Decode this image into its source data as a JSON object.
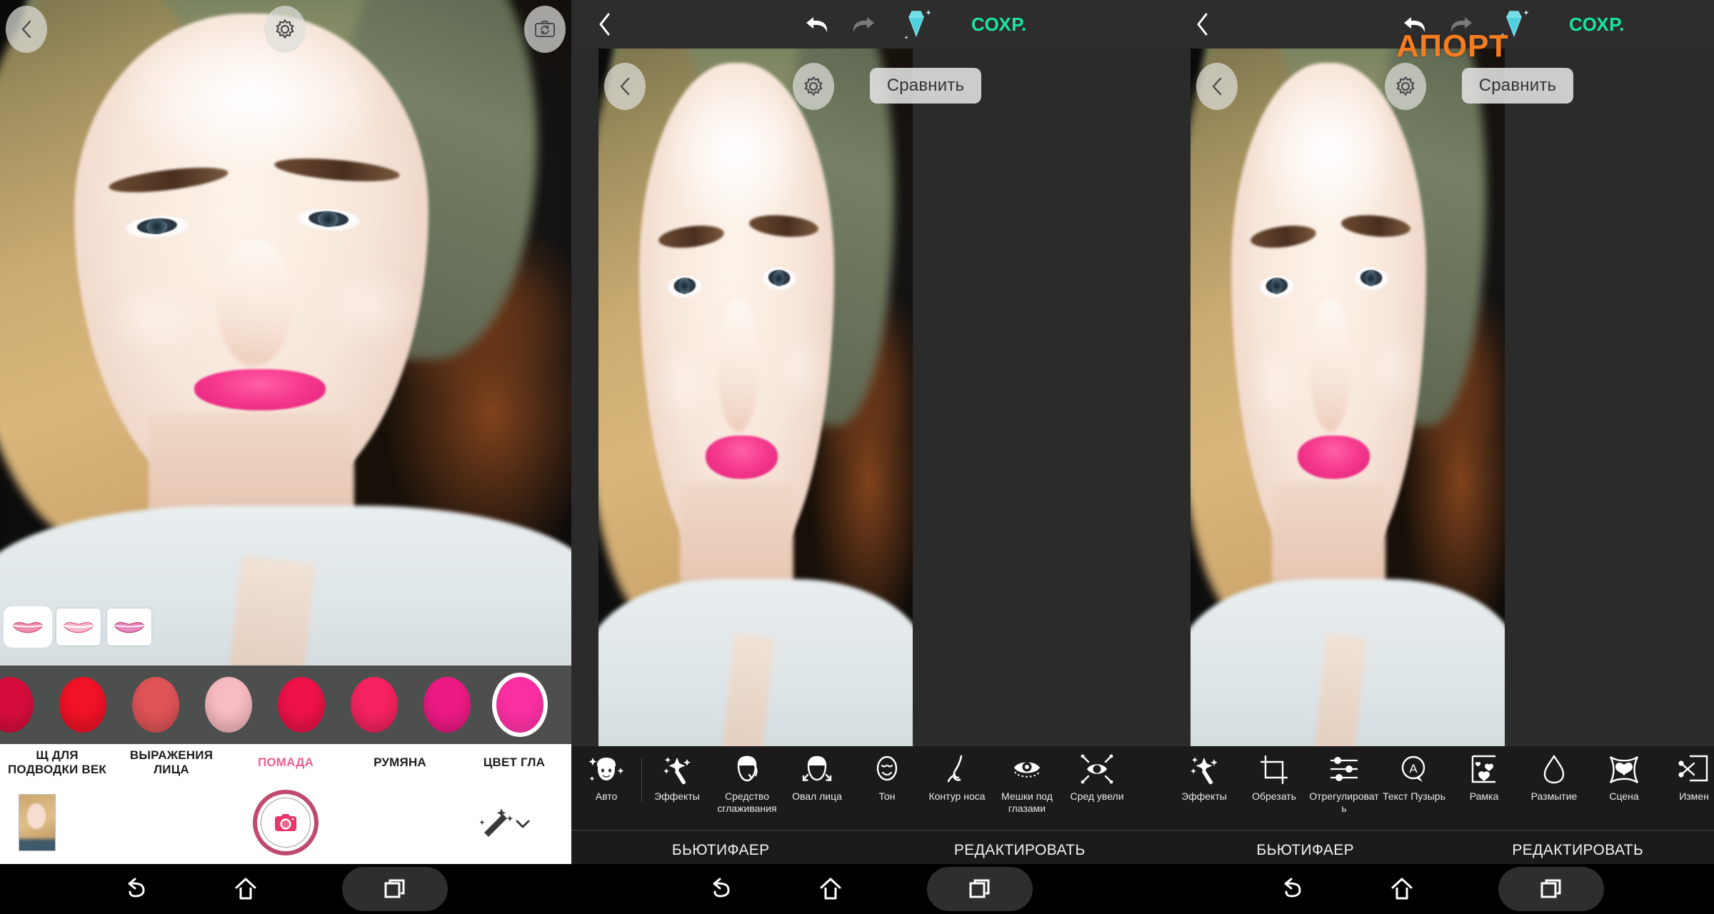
{
  "app": {
    "watermark": "АПОРТ",
    "brand_color": "#F57C1F",
    "save_color": "#16E8A0",
    "accent_pink": "#EF5F94",
    "tab_underline": "#C2185B"
  },
  "left_panel": {
    "top_icons": [
      {
        "name": "back-icon",
        "glyph": "chevron-left"
      },
      {
        "name": "settings-icon",
        "glyph": "gear"
      },
      {
        "name": "switch-camera-icon",
        "glyph": "camera-flip"
      }
    ],
    "lip_thumbs": [
      {
        "label": "lip-style-1",
        "selected": true
      },
      {
        "label": "lip-style-2",
        "selected": false
      },
      {
        "label": "lip-style-3",
        "selected": false
      }
    ],
    "swatches": [
      {
        "color": "#D60D3C",
        "selected": false
      },
      {
        "color": "#F11227",
        "selected": false
      },
      {
        "color": "#E05457",
        "selected": false
      },
      {
        "color": "#F7BBC1",
        "selected": false
      },
      {
        "color": "#EE1249",
        "selected": false
      },
      {
        "color": "#F62360",
        "selected": false
      },
      {
        "color": "#EE1A84",
        "selected": false
      },
      {
        "color": "#FA30A2",
        "selected": true
      }
    ],
    "tabs": [
      {
        "label": "Щ ДЛЯ ПОДВОДКИ ВЕК",
        "active": false
      },
      {
        "label": "ВЫРАЖЕНИЯ ЛИЦА",
        "active": false
      },
      {
        "label": "ПОМАДА",
        "active": true
      },
      {
        "label": "РУМЯНА",
        "active": false
      },
      {
        "label": "ЦВЕТ ГЛА",
        "active": false
      }
    ],
    "camera_bar": {
      "gallery_thumb": "gallery-thumbnail",
      "shutter": "shutter-button",
      "effects": "magic-wand-toggle"
    }
  },
  "mid_panel": {
    "topbar": {
      "back": "back-icon",
      "undo": "undo-icon",
      "redo": "redo-icon",
      "premium": "diamond-icon",
      "save_label": "СОХР."
    },
    "overlay": {
      "back": "back-icon",
      "settings": "gear-icon",
      "compare_label": "Сравнить"
    },
    "tools": [
      {
        "label": "Авто",
        "icon": "auto-face-icon"
      },
      {
        "label": "Эффекты",
        "icon": "magic-wand-icon"
      },
      {
        "label": "Средство сглаживания",
        "icon": "smoothing-face-icon"
      },
      {
        "label": "Овал лица",
        "icon": "face-oval-icon"
      },
      {
        "label": "Тон",
        "icon": "tone-face-icon"
      },
      {
        "label": "Контур носа",
        "icon": "nose-contour-icon"
      },
      {
        "label": "Мешки под глазами",
        "icon": "eye-bags-icon"
      },
      {
        "label": "Сред увели",
        "icon": "eye-enlarge-icon"
      }
    ],
    "tabs": [
      {
        "label": "БЬЮТИФАЕР",
        "active": true
      },
      {
        "label": "РЕДАКТИРОВАТЬ",
        "active": false
      }
    ]
  },
  "right_panel": {
    "topbar": {
      "back": "back-icon",
      "undo": "undo-icon",
      "redo": "redo-icon",
      "premium": "diamond-icon",
      "save_label": "СОХР."
    },
    "overlay": {
      "back": "back-icon",
      "settings": "gear-icon",
      "compare_label": "Сравнить"
    },
    "tools": [
      {
        "label": "Эффекты",
        "icon": "magic-wand-icon"
      },
      {
        "label": "Обрезать",
        "icon": "crop-icon"
      },
      {
        "label": "Отрегулировать",
        "icon": "adjust-sliders-icon"
      },
      {
        "label": "Текст Пузырь",
        "icon": "text-bubble-icon"
      },
      {
        "label": "Рамка",
        "icon": "frame-icon"
      },
      {
        "label": "Размытие",
        "icon": "blur-drop-icon"
      },
      {
        "label": "Сцена",
        "icon": "scene-butterfly-icon"
      },
      {
        "label": "Измен",
        "icon": "cutout-scissors-icon"
      }
    ],
    "tabs": [
      {
        "label": "БЬЮТИФАЕР",
        "active": false
      },
      {
        "label": "РЕДАКТИРОВАТЬ",
        "active": true
      }
    ]
  },
  "navbar": {
    "back": "back-nav-icon",
    "home": "home-nav-icon",
    "recents": "recents-nav-icon"
  }
}
